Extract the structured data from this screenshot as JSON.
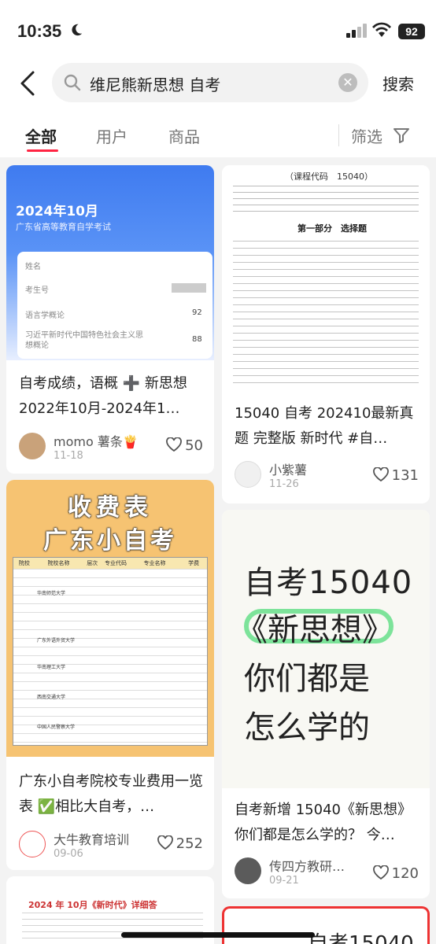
{
  "status": {
    "time": "10:35",
    "battery": "92"
  },
  "search": {
    "query": "维尼熊新思想 自考",
    "button": "搜索"
  },
  "tabs": [
    {
      "label": "全部"
    },
    {
      "label": "用户"
    },
    {
      "label": "商品"
    }
  ],
  "filter": {
    "label": "筛选"
  },
  "cards": [
    {
      "image": {
        "date": "2024年10月",
        "subtitle": "广东省高等教育自学考试",
        "rows": [
          "姓名",
          "考生号",
          "语言学概论",
          "习近平新时代中国特色社会主义思想概论"
        ],
        "scores": [
          "92",
          "88"
        ]
      },
      "title": "自考成绩，语概 ➕ 新思想 2022年10月-2024年1…",
      "author": "momo 薯条🍟",
      "date": "11-18",
      "likes": "50"
    },
    {
      "image": {
        "code": "（课程代码　15040）",
        "section": "第一部分　选择题"
      },
      "title": "15040 自考 202410最新真题 完整版 新时代 #自…",
      "author": "小紫薯",
      "date": "11-26",
      "likes": "131"
    },
    {
      "image": {
        "line1": "收费表",
        "line2": "广东小自考",
        "headers": [
          "院校",
          "院校名称",
          "层次",
          "专业代码",
          "专业名称",
          "学费"
        ],
        "schools": [
          "华南师范大学",
          "广东外语外贸大学",
          "华南理工大学",
          "西南交通大学",
          "中国人民警察大学"
        ]
      },
      "title": "广东小自考院校专业费用一览表 ✅相比大自考，…",
      "author": "大牛教育培训",
      "date": "09-06",
      "likes": "252"
    },
    {
      "image": {
        "line1": "自考15040",
        "line2": "《新思想》",
        "line3": "你们都是",
        "line4": "怎么学的"
      },
      "title": "自考新增 15040《新思想》你们都是怎么学的？ 今…",
      "author": "传四方教研…",
      "date": "09-21",
      "likes": "120"
    },
    {
      "image": {
        "heading": "2024 年 10月《新时代》详细答"
      }
    },
    {
      "image": {
        "text": "自考15040"
      }
    }
  ]
}
